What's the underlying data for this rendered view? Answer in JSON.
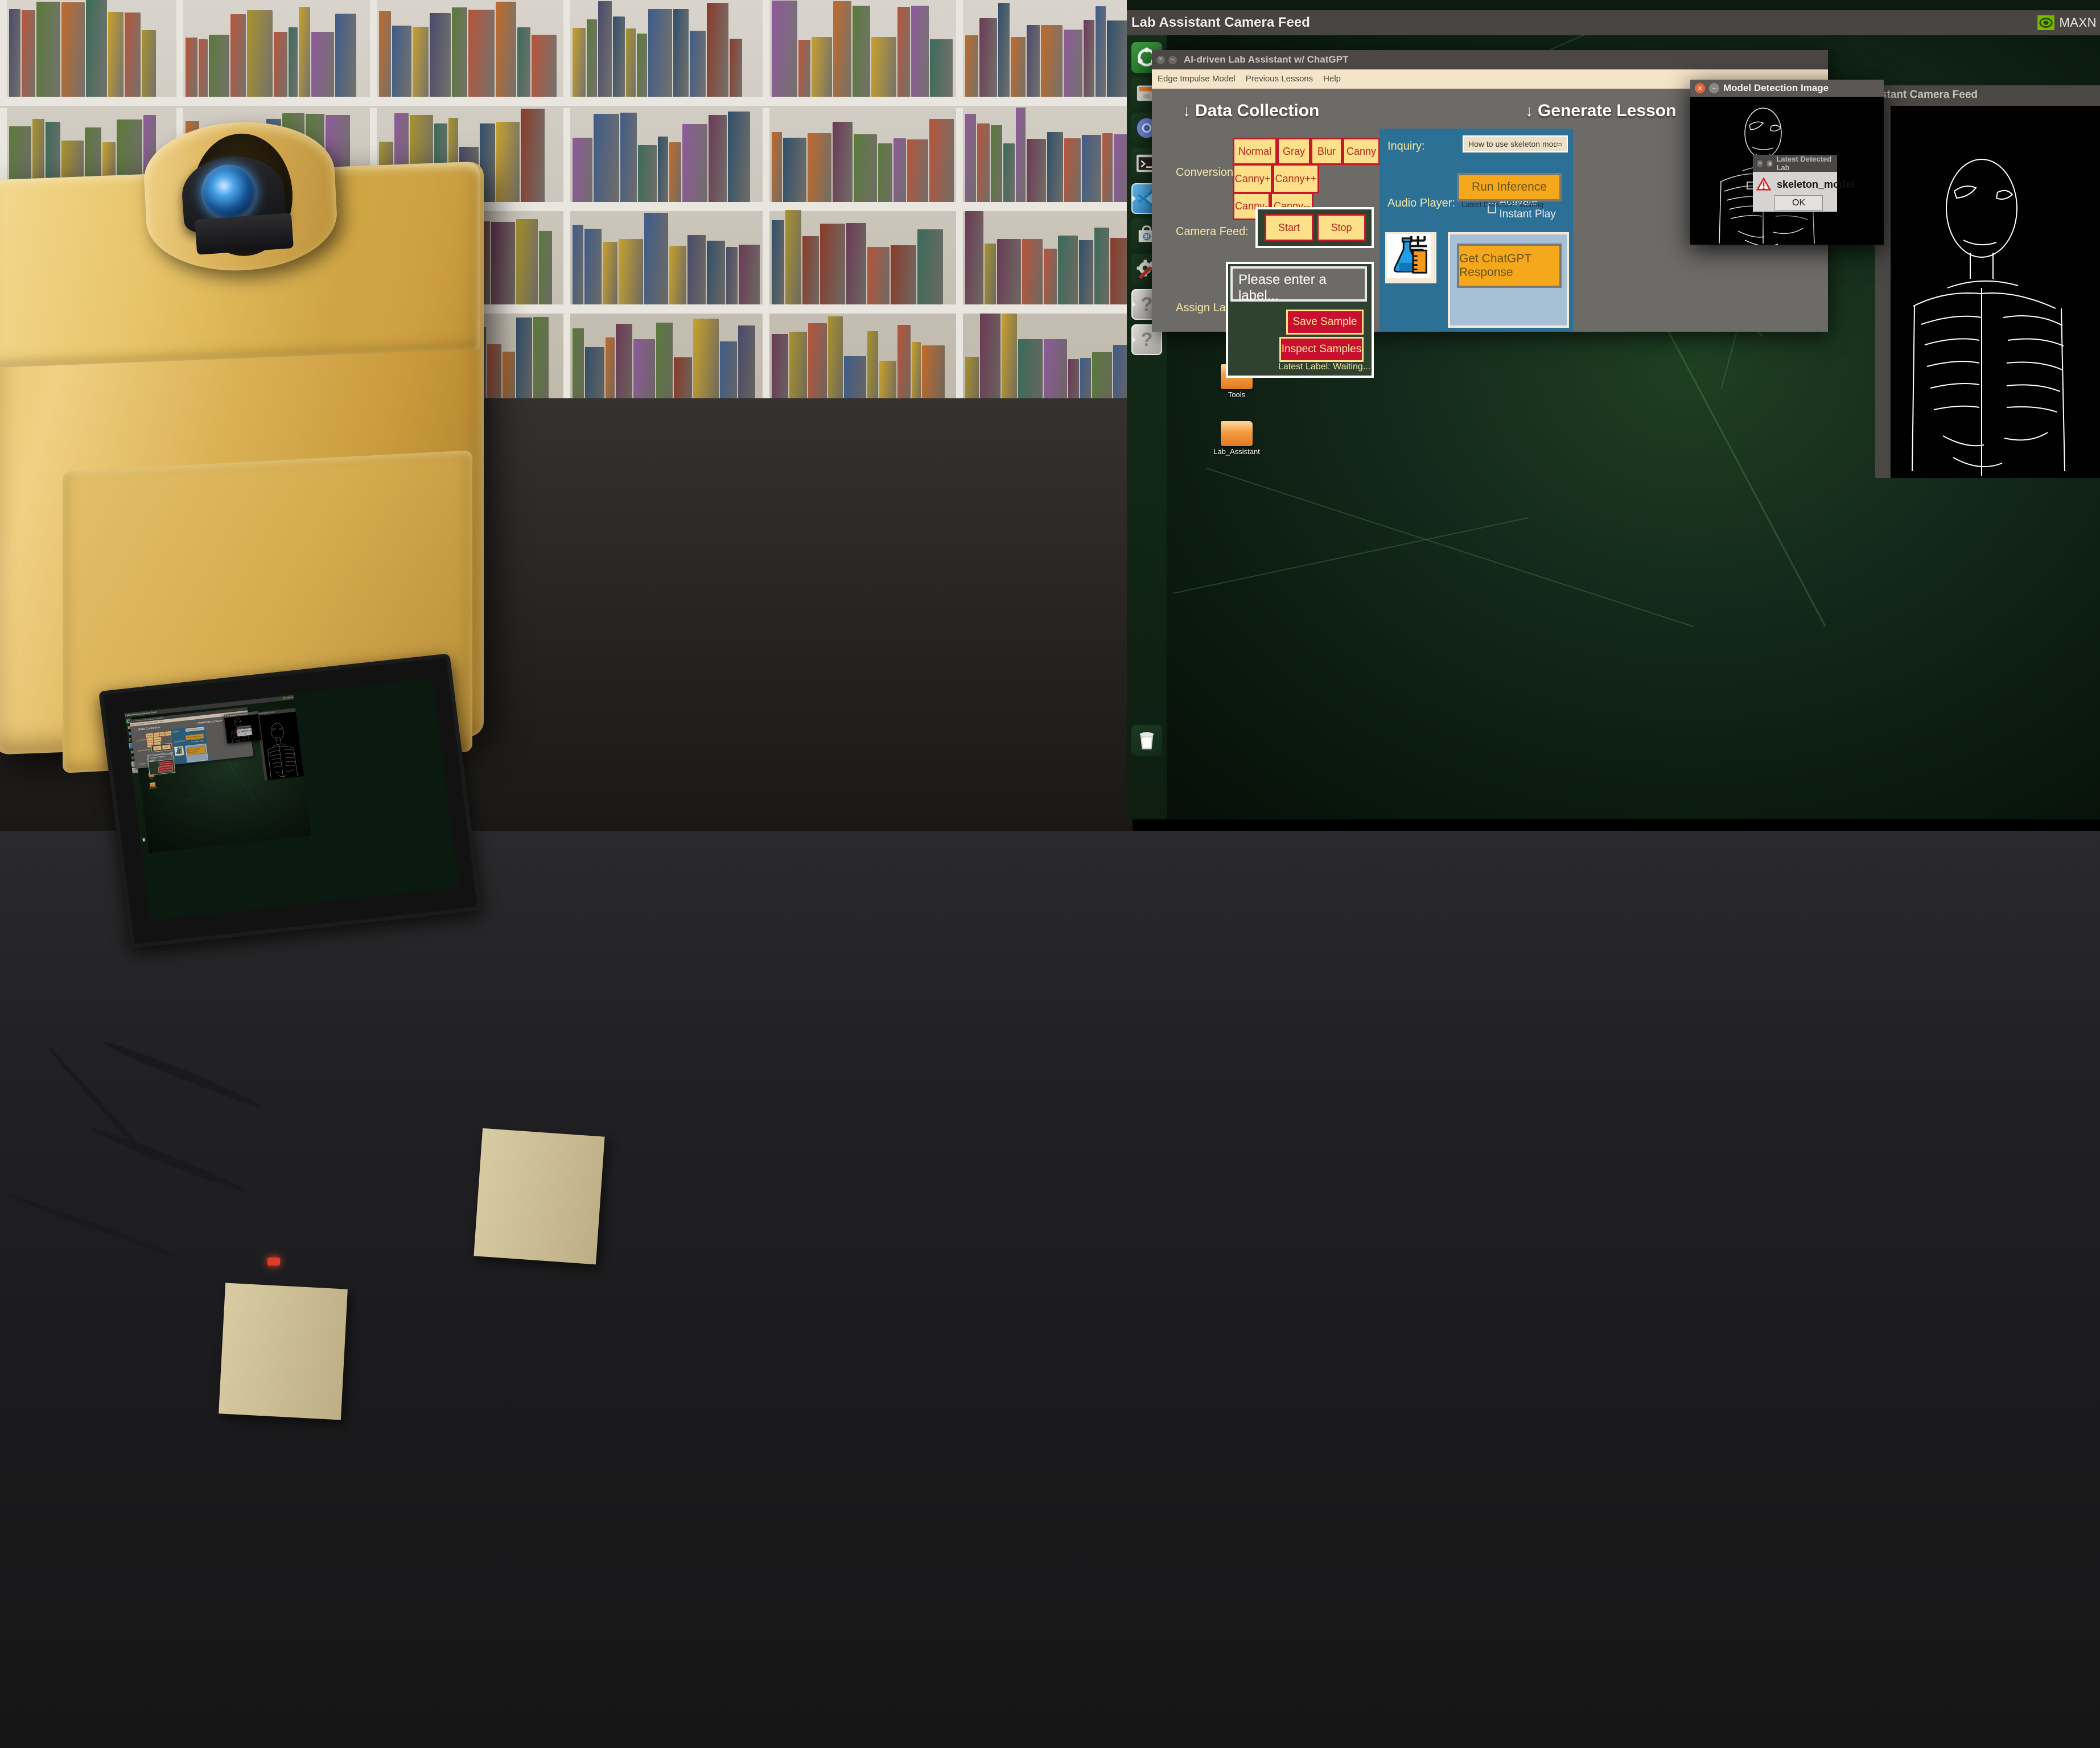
{
  "photo": {
    "description": "3D-printed gold enclosure lab assistant device with webcam and touchscreen on a dark desk in front of a bookshelf",
    "device_screen_mirrors": "same desktop screenshot"
  },
  "desktop": {
    "topbar": {
      "window_title": "Lab Assistant Camera Feed",
      "nvidia_indicator": "MAXN",
      "nvidia_icon": "nvidia-eye-icon"
    },
    "launcher": {
      "items": [
        {
          "name": "ubuntu-dash-icon",
          "label": "Ubuntu Dash"
        },
        {
          "name": "files-icon",
          "label": "Files"
        },
        {
          "name": "chromium-icon",
          "label": "Chromium"
        },
        {
          "name": "terminal-icon",
          "label": "Terminal"
        },
        {
          "name": "vscode-icon",
          "label": "Visual Studio Code"
        },
        {
          "name": "software-center-icon",
          "label": "Ubuntu Software"
        },
        {
          "name": "settings-icon",
          "label": "System Settings"
        },
        {
          "name": "unknown-app-icon",
          "label": "Unknown Application"
        },
        {
          "name": "unknown-app-icon",
          "label": "Unknown Application"
        },
        {
          "name": "trash-icon",
          "label": "Trash"
        }
      ]
    },
    "folders": [
      {
        "label": "Tools"
      },
      {
        "label": "Lab_Assistant"
      }
    ],
    "background_window": {
      "title": "Lab Assistant Camera Feed",
      "title_clipped": "stant Camera Feed"
    }
  },
  "app": {
    "title": "AI-driven Lab Assistant w/ ChatGPT",
    "menu": [
      "Edge Impulse Model",
      "Previous Lessons",
      "Help"
    ],
    "left": {
      "heading": "Data Collection",
      "heading_arrow": "↓",
      "conversions_label": "Conversions:",
      "conversions": [
        "Normal",
        "Gray",
        "Blur",
        "Canny",
        "Canny+",
        "Canny++",
        "Canny-",
        "Canny--"
      ],
      "camera_feed_label": "Camera Feed:",
      "camera_buttons": [
        "Start",
        "Stop"
      ],
      "assign_label": "Assign Label:",
      "label_input_value": "Please enter a label...",
      "save_sample": "Save Sample",
      "inspect_samples": "Inspect Samples",
      "latest_label": "Latest Label: Waiting..."
    },
    "right": {
      "heading": "Generate Lesson",
      "heading_arrow": "↓",
      "inquiry_label": "Inquiry:",
      "inquiry_value": "How to use skeleton model in labs?",
      "audio_player_label": "Audio Player:",
      "instant_play_label": "Activate Instant Play",
      "instant_play_checked": false,
      "run_inference": "Run Inference",
      "latest_detection": "Latest Detection: Waiting",
      "get_response": "Get ChatGPT Response",
      "lab_icon": "flask-beaker-icon"
    }
  },
  "dialogs": {
    "detected": {
      "title": "Latest Detected Lab",
      "title_clipped": "Latest Detected Lab",
      "message": "skeleton_model",
      "icon": "warning-triangle-icon",
      "ok": "OK"
    },
    "detection_image": {
      "title": "Model Detection Image",
      "close_icon": "close-icon",
      "minimize_icon": "minimize-icon",
      "content": "canny edge-detected skeleton torso on black"
    }
  },
  "colors": {
    "accent_yellow": "#ffe08a",
    "accent_red": "#c3192b",
    "panel_blue": "#2c7095",
    "orange": "#f5a81c",
    "window_gray": "#6d6b68",
    "menu_cream": "#f6e4c8"
  }
}
